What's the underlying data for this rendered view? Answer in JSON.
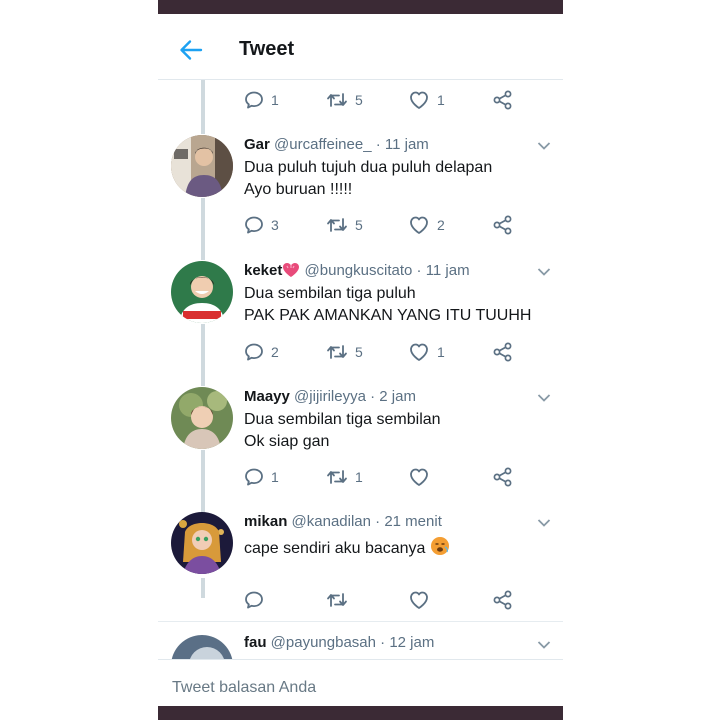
{
  "header": {
    "title": "Tweet",
    "back_icon": "arrow-left-icon"
  },
  "colors": {
    "accent": "#1da1f2",
    "text": "#14171a",
    "muted": "#5b7083",
    "divider": "#e6ecf0"
  },
  "top_actions": {
    "replies": "1",
    "retweets": "5",
    "likes": "1"
  },
  "tweets": [
    {
      "name": "Gar",
      "handle": "@urcaffeinee_",
      "time": "11 jam",
      "lines": [
        "Dua puluh tujuh dua puluh delapan",
        "Ayo buruan !!!!!"
      ],
      "replies": "3",
      "retweets": "5",
      "likes": "2"
    },
    {
      "name": "keket",
      "name_emoji": "heart-emoji",
      "handle": "@bungkuscitato",
      "time": "11 jam",
      "lines": [
        "Dua sembilan tiga puluh",
        "PAK PAK AMANKAN YANG ITU TUUHH"
      ],
      "replies": "2",
      "retweets": "5",
      "likes": "1"
    },
    {
      "name": "Maayy",
      "handle": "@jijirileyya",
      "time": "2 jam",
      "lines": [
        "Dua sembilan tiga sembilan",
        "Ok siap gan"
      ],
      "replies": "1",
      "retweets": "1",
      "likes": ""
    },
    {
      "name": "mikan",
      "handle": "@kanadilan",
      "time": "21 menit",
      "lines": [
        "cape sendiri aku bacanya"
      ],
      "line_emoji": "hot-face-emoji",
      "replies": "",
      "retweets": "",
      "likes": ""
    },
    {
      "name": "fau",
      "handle": "@payungbasah",
      "time": "12 jam"
    }
  ],
  "reply_bar": {
    "placeholder": "Tweet balasan Anda"
  }
}
